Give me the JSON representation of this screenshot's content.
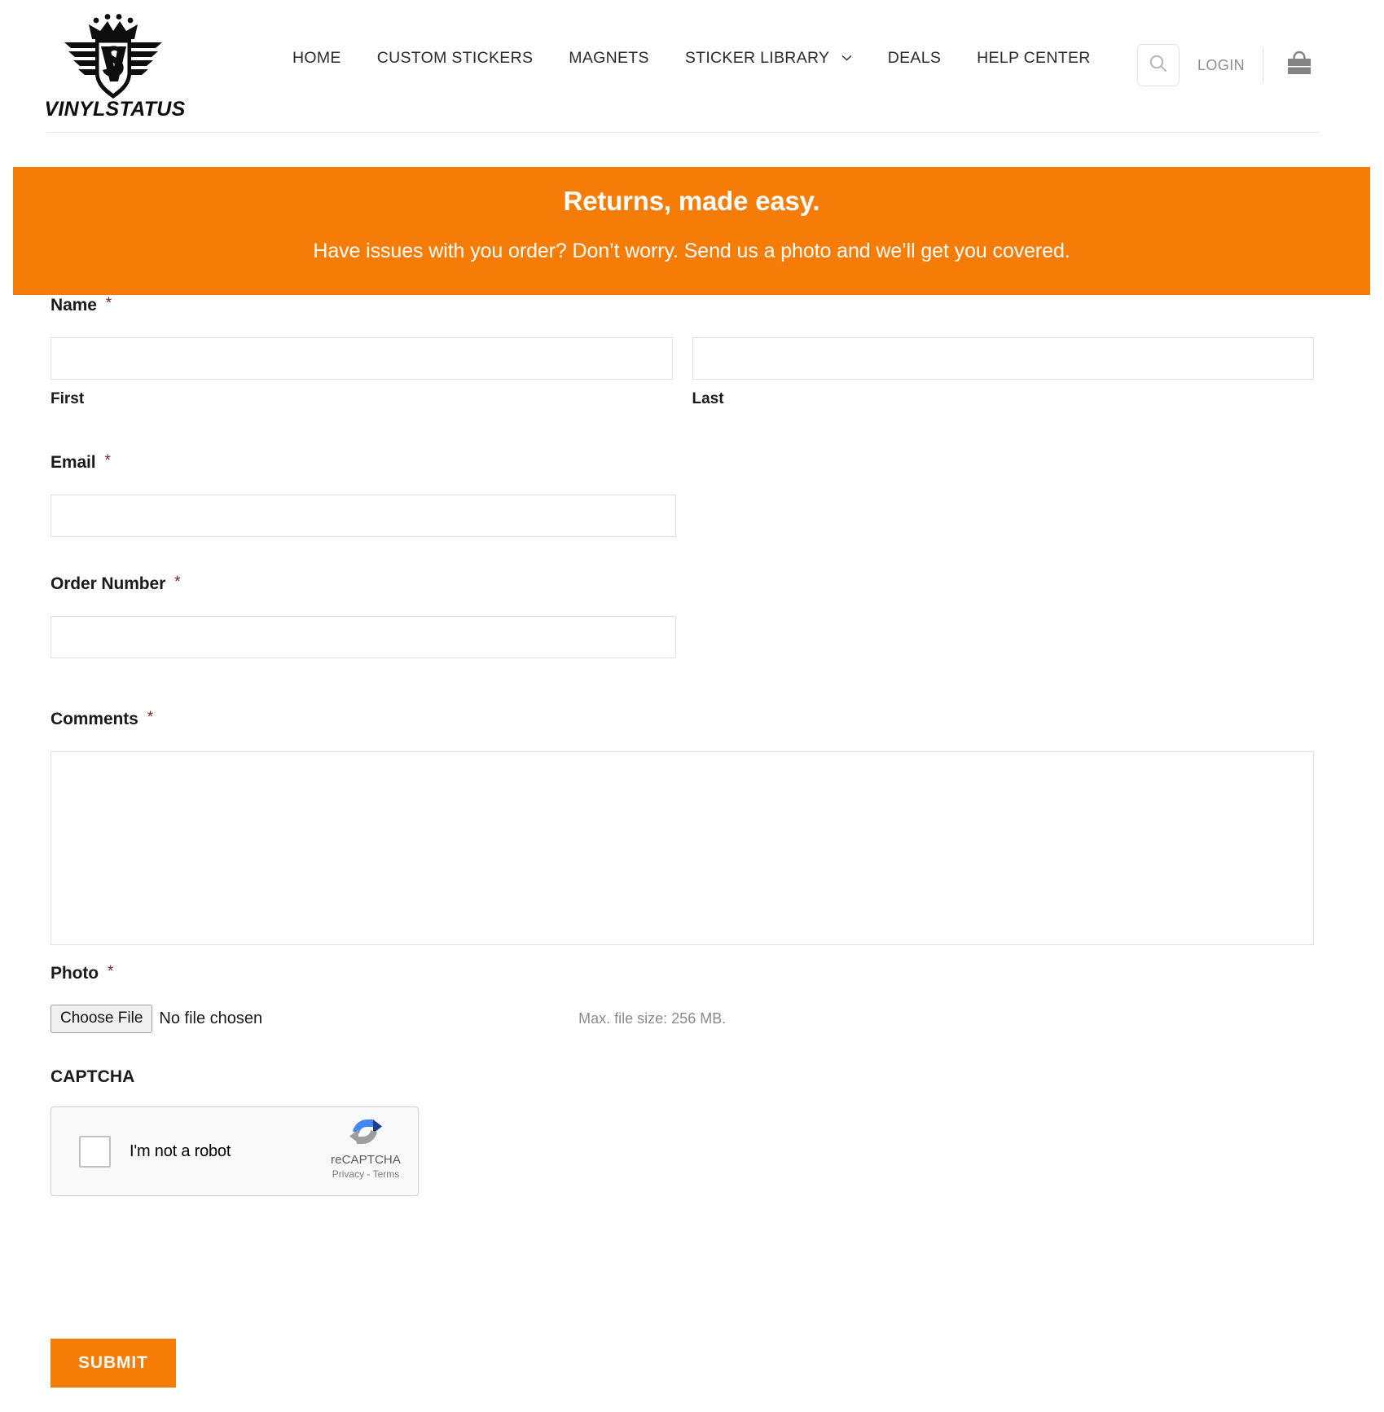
{
  "header": {
    "logo_text": "VINYLSTATUS",
    "logo_icon": "winged-shield-crown-logo",
    "nav": [
      {
        "label": "HOME",
        "has_dropdown": false
      },
      {
        "label": "CUSTOM STICKERS",
        "has_dropdown": false
      },
      {
        "label": "MAGNETS",
        "has_dropdown": false
      },
      {
        "label": "STICKER LIBRARY",
        "has_dropdown": true
      },
      {
        "label": "DEALS",
        "has_dropdown": false
      },
      {
        "label": "HELP CENTER",
        "has_dropdown": false
      }
    ],
    "search_icon": "search-icon",
    "login_label": "LOGIN",
    "cart_icon": "shopping-bag-icon"
  },
  "banner": {
    "title": "Returns, made easy.",
    "subtitle": "Have issues with you order? Don’t worry. Send us a photo and we’ll get you covered.",
    "background_color": "#F57C06",
    "text_color": "#FFFFFF"
  },
  "form": {
    "required_marker": "*",
    "name": {
      "label": "Name",
      "first_sublabel": "First",
      "last_sublabel": "Last",
      "first_value": "",
      "last_value": ""
    },
    "email": {
      "label": "Email",
      "value": ""
    },
    "order_number": {
      "label": "Order Number",
      "value": ""
    },
    "comments": {
      "label": "Comments",
      "value": ""
    },
    "photo": {
      "label": "Photo",
      "choose_button": "Choose File",
      "file_status": "No file chosen",
      "max_size_note": "Max. file size: 256 MB."
    },
    "captcha": {
      "label": "CAPTCHA",
      "checkbox_text": "I'm not a robot",
      "brand": "reCAPTCHA",
      "privacy": "Privacy",
      "separator": "-",
      "terms": "Terms"
    },
    "submit_label": "SUBMIT",
    "submit_color": "#F57C06"
  }
}
